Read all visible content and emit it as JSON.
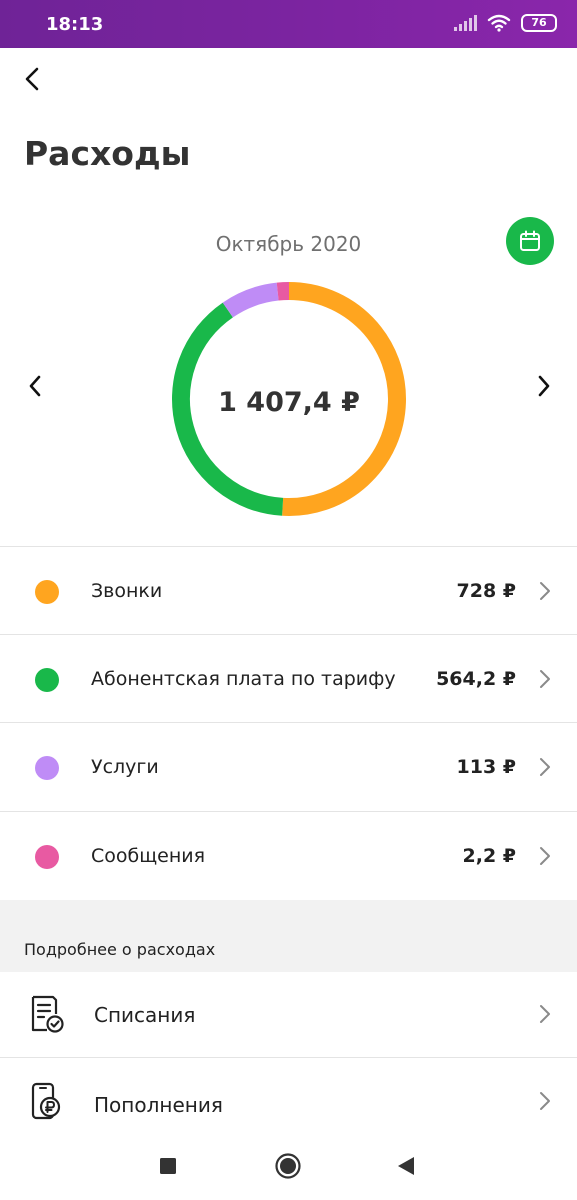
{
  "status_bar": {
    "time": "18:13",
    "battery": "76"
  },
  "header": {
    "title": "Расходы"
  },
  "chart": {
    "month": "Октябрь 2020",
    "total": "1 407,4 ₽"
  },
  "chart_data": {
    "type": "pie",
    "categories": [
      "Звонки",
      "Абонентская плата по тарифу",
      "Услуги",
      "Сообщения"
    ],
    "values": [
      728,
      564.2,
      113,
      2.2
    ],
    "colors": [
      "#ffa51f",
      "#19b84a",
      "#bf8cf6",
      "#e85aa2"
    ],
    "title": "",
    "donut": true
  },
  "categories": [
    {
      "name": "Звонки",
      "amount": "728 ₽",
      "color": "#ffa51f"
    },
    {
      "name": "Абонентская плата по тарифу",
      "amount": "564,2 ₽",
      "color": "#19b84a"
    },
    {
      "name": "Услуги",
      "amount": "113 ₽",
      "color": "#bf8cf6"
    },
    {
      "name": "Сообщения",
      "amount": "2,2 ₽",
      "color": "#e85aa2"
    }
  ],
  "details": {
    "heading": "Подробнее о расходах",
    "items": [
      {
        "label": "Списания",
        "icon": "receipt-check-icon"
      },
      {
        "label": "Пополнения",
        "icon": "phone-ruble-icon"
      }
    ]
  },
  "icons": {
    "back": "back-arrow-icon",
    "calendar": "calendar-icon",
    "prev": "chevron-left-icon",
    "next": "chevron-right-icon"
  }
}
